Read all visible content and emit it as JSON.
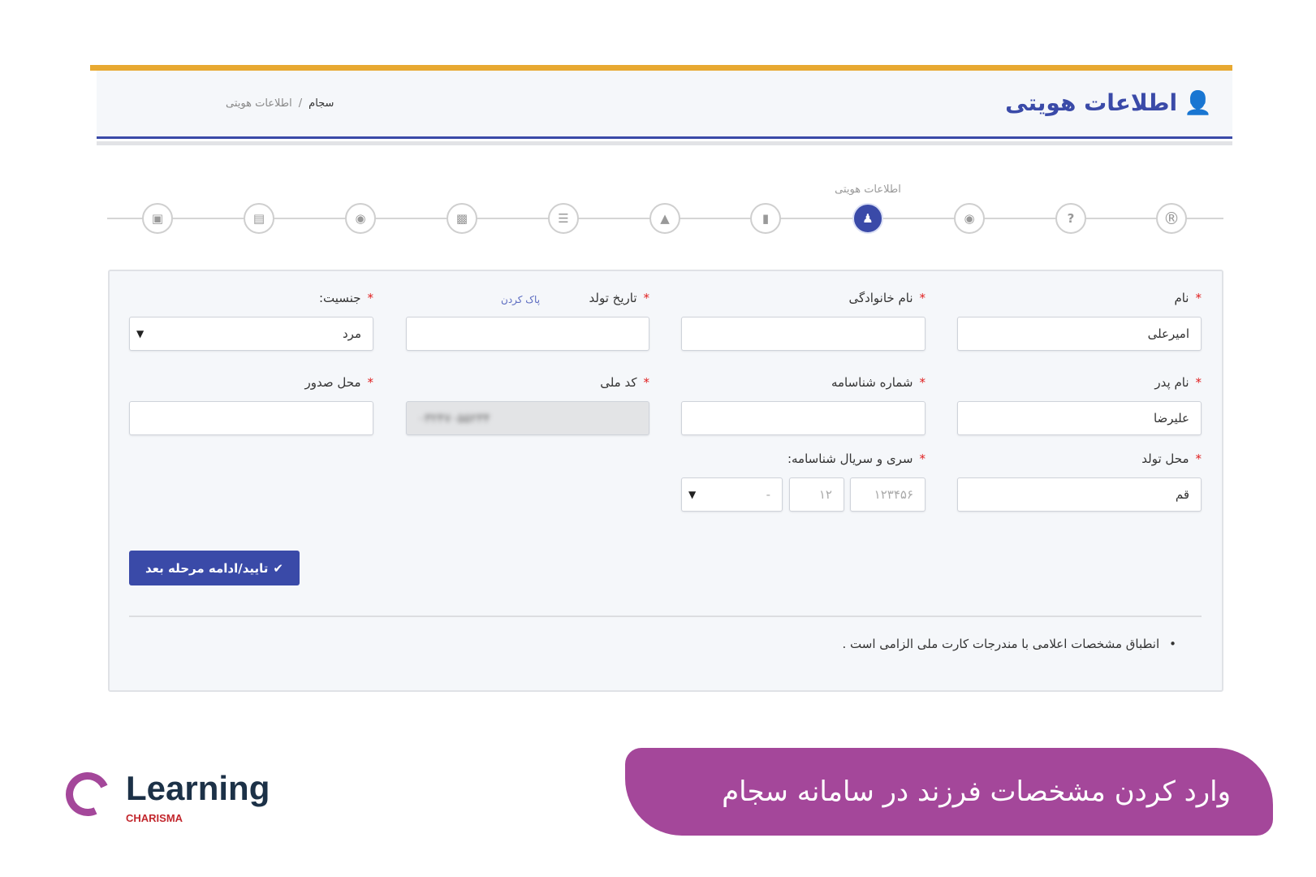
{
  "header": {
    "title": "اطلاعات هویتی",
    "title_icon": "user-icon",
    "breadcrumb": [
      "سجام",
      "/",
      "اطلاعات هویتی"
    ]
  },
  "steps": {
    "active_label": "اطلاعات هویتی",
    "icons": [
      "contact-card-icon",
      "credit-card-icon",
      "money-icon",
      "briefcase-icon",
      "list-icon",
      "graduation-cap-icon",
      "bookmark-icon",
      "person-icon",
      "money-icon",
      "question-icon",
      "registered-icon"
    ],
    "active_index": 7
  },
  "form": {
    "first_name": {
      "label": "نام",
      "value": "امیرعلی"
    },
    "last_name": {
      "label": "نام خانوادگی",
      "value": ""
    },
    "birth_date": {
      "label": "تاریخ تولد",
      "value": "",
      "clear": "پاک کردن"
    },
    "gender": {
      "label": "جنسیت:",
      "value": "مرد"
    },
    "father_name": {
      "label": "نام پدر",
      "value": "علیرضا"
    },
    "id_number": {
      "label": "شماره شناسامه",
      "value": ""
    },
    "national_code": {
      "label": "کد ملی",
      "value": "۰۳۲۴۷۰۵۵۲۳۴"
    },
    "issue_place": {
      "label": "محل صدور",
      "value": ""
    },
    "birth_place": {
      "label": "محل تولد",
      "value": "قم"
    },
    "serial": {
      "label": "سری و سریال شناسامه:",
      "serial_placeholder": "۱۲۳۴۵۶",
      "series_placeholder": "۱۲",
      "letter_value": "-"
    },
    "required_mark": "*",
    "submit": "تایید/ادامه مرحله بعد",
    "note": "انطباق مشخصات اعلامی با مندرجات کارت ملی الزامی است ."
  },
  "banner": {
    "text": "وارد کردن مشخصات فرزند در سامانه سجام"
  },
  "logo": {
    "word": "Learning",
    "sub": "CHARISMA"
  },
  "colors": {
    "accent": "#3a4aa8",
    "top_bar": "#e8a931",
    "banner": "#a4479a",
    "required": "#e02020"
  }
}
